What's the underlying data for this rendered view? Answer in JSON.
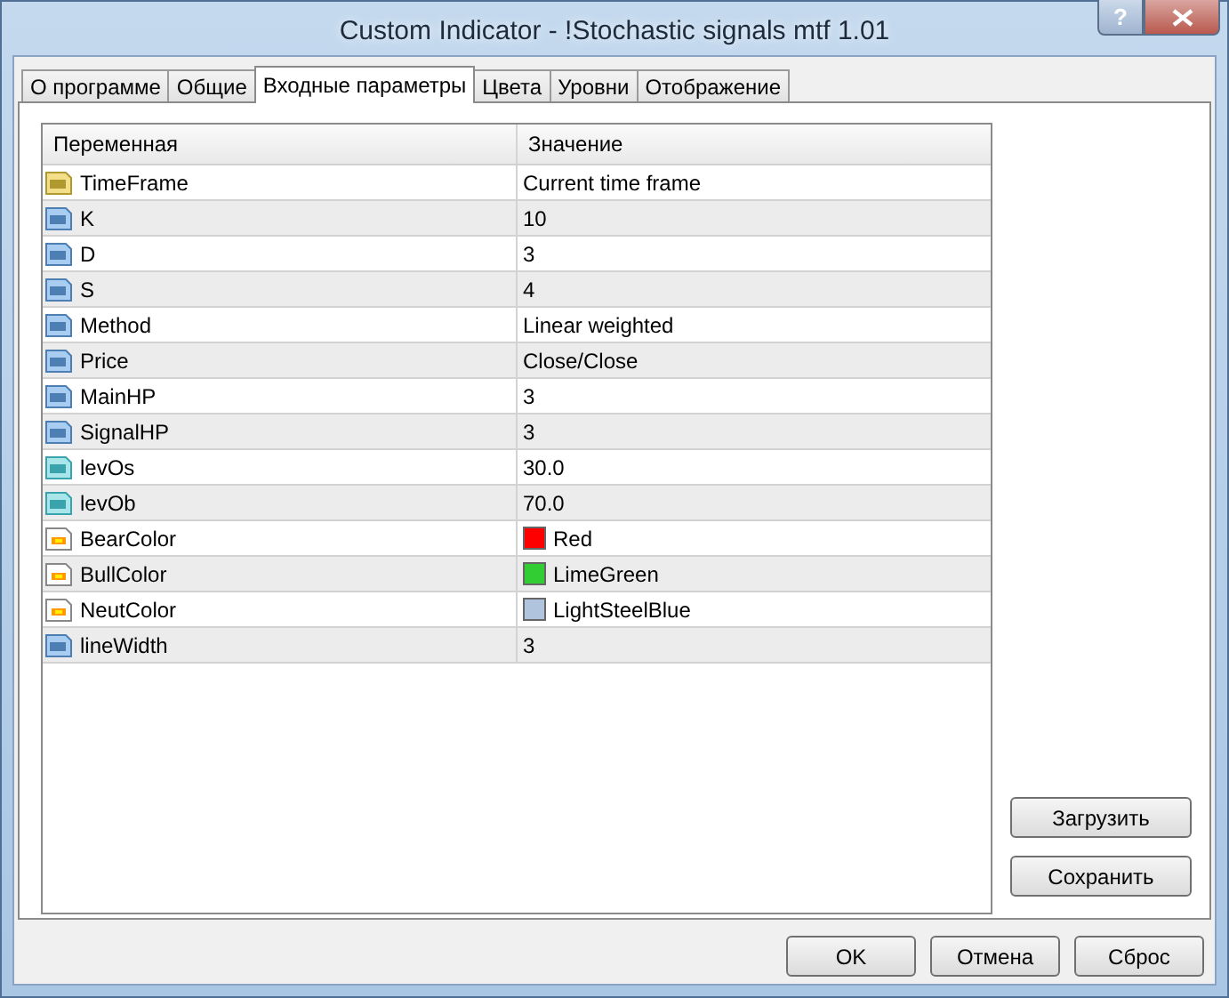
{
  "window": {
    "title": "Custom Indicator - !Stochastic signals mtf 1.01",
    "help": "?"
  },
  "tabs": [
    {
      "label": "О программе",
      "selected": false
    },
    {
      "label": "Общие",
      "selected": false
    },
    {
      "label": "Входные параметры",
      "selected": true
    },
    {
      "label": "Цвета",
      "selected": false
    },
    {
      "label": "Уровни",
      "selected": false
    },
    {
      "label": "Отображение",
      "selected": false
    }
  ],
  "table": {
    "columns": [
      "Переменная",
      "Значение"
    ],
    "rows": [
      {
        "kind": "string",
        "name": "TimeFrame",
        "value": "Current time frame"
      },
      {
        "kind": "int",
        "name": "K",
        "value": "10"
      },
      {
        "kind": "int",
        "name": "D",
        "value": "3"
      },
      {
        "kind": "int",
        "name": "S",
        "value": "4"
      },
      {
        "kind": "int",
        "name": "Method",
        "value": "Linear weighted"
      },
      {
        "kind": "int",
        "name": "Price",
        "value": "Close/Close"
      },
      {
        "kind": "int",
        "name": "MainHP",
        "value": "3"
      },
      {
        "kind": "int",
        "name": "SignalHP",
        "value": "3"
      },
      {
        "kind": "double",
        "name": "levOs",
        "value": "30.0"
      },
      {
        "kind": "double",
        "name": "levOb",
        "value": "70.0"
      },
      {
        "kind": "color",
        "name": "BearColor",
        "value": "Red",
        "color": "#ff0000"
      },
      {
        "kind": "color",
        "name": "BullColor",
        "value": "LimeGreen",
        "color": "#32cd32"
      },
      {
        "kind": "color",
        "name": "NeutColor",
        "value": "LightSteelBlue",
        "color": "#b0c4de"
      },
      {
        "kind": "int",
        "name": "lineWidth",
        "value": "3"
      }
    ]
  },
  "side_buttons": [
    "Загрузить",
    "Сохранить"
  ],
  "buttons": [
    "OK",
    "Отмена",
    "Сброс"
  ]
}
